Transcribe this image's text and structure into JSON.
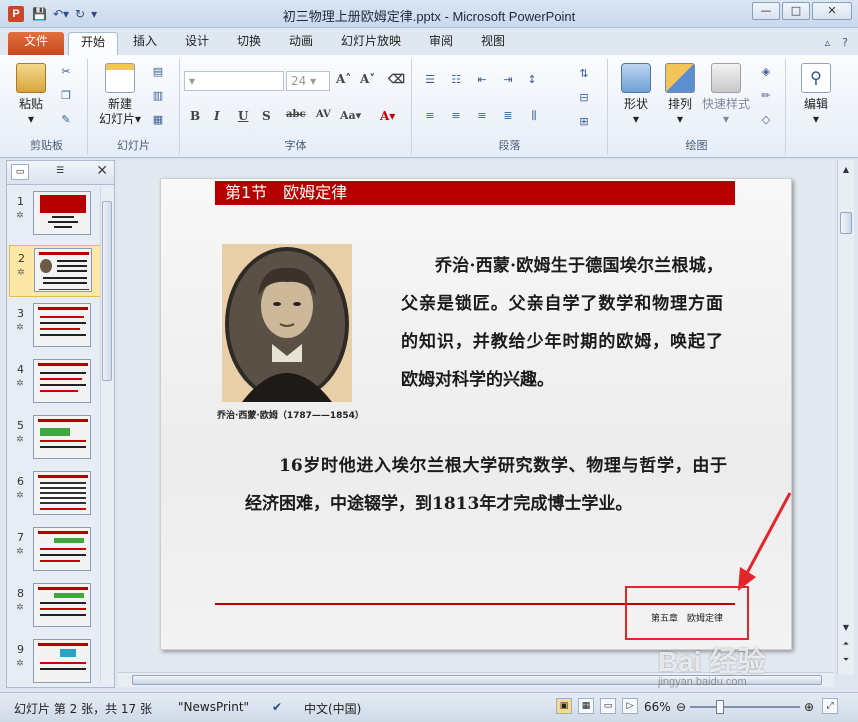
{
  "window": {
    "title": "初三物理上册欧姆定律.pptx - Microsoft PowerPoint",
    "app_icon": "P",
    "minimize": "—",
    "maximize": "□",
    "close": "✕"
  },
  "tabs": {
    "file": "文件",
    "items": [
      "开始",
      "插入",
      "设计",
      "切换",
      "动画",
      "幻灯片放映",
      "审阅",
      "视图"
    ]
  },
  "ribbon": {
    "paste": "粘贴",
    "clipboard": "剪贴板",
    "new_slide_1": "新建",
    "new_slide_2": "幻灯片",
    "slides": "幻灯片",
    "font_size": "24",
    "font_group": "字体",
    "paragraph": "段落",
    "shape": "形状",
    "arrange": "排列",
    "quick_style": "快速样式",
    "drawing": "绘图",
    "edit": "编辑"
  },
  "thumbnails": [
    "1",
    "2",
    "3",
    "4",
    "5",
    "6",
    "7",
    "8",
    "9"
  ],
  "slide": {
    "header": "第1节　欧姆定律",
    "caption": "乔治·西蒙·欧姆（1787——1854）",
    "paragraph1": "乔治·西蒙·欧姆生于德国埃尔兰根城，父亲是锁匠。父亲自学了数学和物理方面的知识，并教给少年时期的欧姆，唤起了欧姆对科学的兴趣。",
    "paragraph2": "16岁时他进入埃尔兰根大学研究数学、物理与哲学，由于经济困难，中途辍学，到1813年才完成博士学业。",
    "footer": "第五章　欧姆定律"
  },
  "status": {
    "slide_info": "幻灯片 第 2 张，共 17 张",
    "theme": "\"NewsPrint\"",
    "language": "中文(中国)",
    "zoom": "66%"
  },
  "watermark": {
    "brand": "Bai 经验",
    "url": "jingyan.baidu.com"
  },
  "colors": {
    "accent_red": "#b60000",
    "file_tab": "#d1541f",
    "annotation": "#e3262b"
  }
}
